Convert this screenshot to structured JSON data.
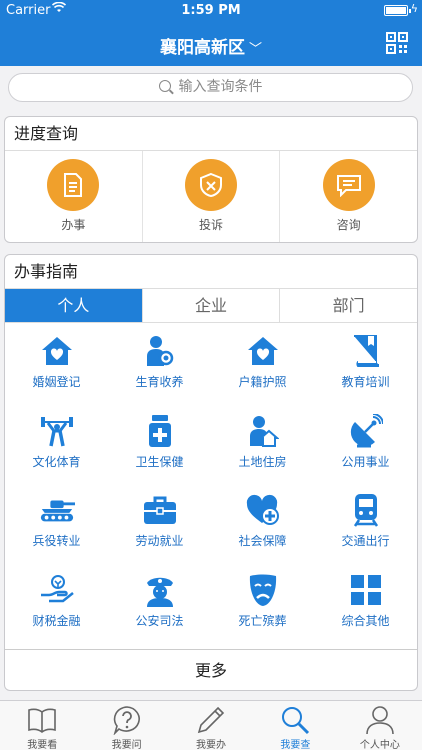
{
  "status_bar": {
    "carrier": "Carrier",
    "time": "1:59 PM"
  },
  "nav": {
    "title": "襄阳高新区",
    "qr_icon": "qr-code-icon"
  },
  "search": {
    "placeholder": "输入查询条件"
  },
  "progress": {
    "title": "进度查询",
    "items": [
      {
        "label": "办事",
        "icon": "document-icon"
      },
      {
        "label": "投诉",
        "icon": "shield-icon"
      },
      {
        "label": "咨询",
        "icon": "message-icon"
      }
    ]
  },
  "guide": {
    "title": "办事指南",
    "tabs": [
      "个人",
      "企业",
      "部门"
    ],
    "active_tab": "个人",
    "items": [
      {
        "label": "婚姻登记",
        "icon": "house-heart-icon"
      },
      {
        "label": "生育收养",
        "icon": "person-baby-icon"
      },
      {
        "label": "户籍护照",
        "icon": "house-heart-icon"
      },
      {
        "label": "教育培训",
        "icon": "book-icon"
      },
      {
        "label": "文化体育",
        "icon": "weightlifter-icon"
      },
      {
        "label": "卫生保健",
        "icon": "medicine-bottle-icon"
      },
      {
        "label": "土地住房",
        "icon": "person-house-icon"
      },
      {
        "label": "公用事业",
        "icon": "satellite-dish-icon"
      },
      {
        "label": "兵役转业",
        "icon": "tank-icon"
      },
      {
        "label": "劳动就业",
        "icon": "briefcase-icon"
      },
      {
        "label": "社会保障",
        "icon": "heart-plus-icon"
      },
      {
        "label": "交通出行",
        "icon": "train-icon"
      },
      {
        "label": "财税金融",
        "icon": "hand-coin-icon"
      },
      {
        "label": "公安司法",
        "icon": "police-icon"
      },
      {
        "label": "死亡殡葬",
        "icon": "mask-icon"
      },
      {
        "label": "综合其他",
        "icon": "grid-icon"
      }
    ],
    "more_label": "更多"
  },
  "tabbar": [
    {
      "label": "我要看",
      "icon": "book-open-icon"
    },
    {
      "label": "我要问",
      "icon": "question-icon"
    },
    {
      "label": "我要办",
      "icon": "pencil-icon"
    },
    {
      "label": "我要查",
      "icon": "search-icon",
      "active": true
    },
    {
      "label": "个人中心",
      "icon": "user-icon"
    }
  ],
  "colors": {
    "primary": "#1f7fd8",
    "accent_orange": "#f0a02c",
    "icon_blue": "#1f7fd8"
  }
}
